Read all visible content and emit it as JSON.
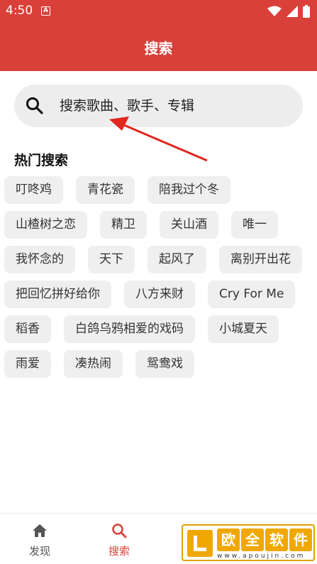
{
  "status_bar": {
    "time": "4:50",
    "notification_glyph": "A"
  },
  "header": {
    "title": "搜索"
  },
  "search": {
    "placeholder": "搜索歌曲、歌手、专辑"
  },
  "hot": {
    "title": "热门搜索",
    "rows": [
      [
        "叮咚鸡",
        "青花瓷",
        "陪我过个冬"
      ],
      [
        "山楂树之恋",
        "精卫",
        "关山酒",
        "唯一"
      ],
      [
        "我怀念的",
        "天下",
        "起风了",
        "离别开出花"
      ],
      [
        "把回忆拼好给你",
        "八方来财",
        "Cry For Me"
      ],
      [
        "稻香",
        "白鸽乌鸦相爱的戏码",
        "小城夏天"
      ],
      [
        "雨爱",
        "凑热闹",
        "鸳鸯戏"
      ]
    ]
  },
  "nav": {
    "items": [
      {
        "label": "发现",
        "icon": "home-icon"
      },
      {
        "label": "搜索",
        "icon": "search-icon",
        "active": true
      },
      {
        "label": "",
        "icon": "music-icon"
      },
      {
        "label": "",
        "icon": "user-icon"
      }
    ]
  },
  "colors": {
    "accent": "#d9403a",
    "chip_bg": "#efefef",
    "search_bg": "#ededed"
  }
}
